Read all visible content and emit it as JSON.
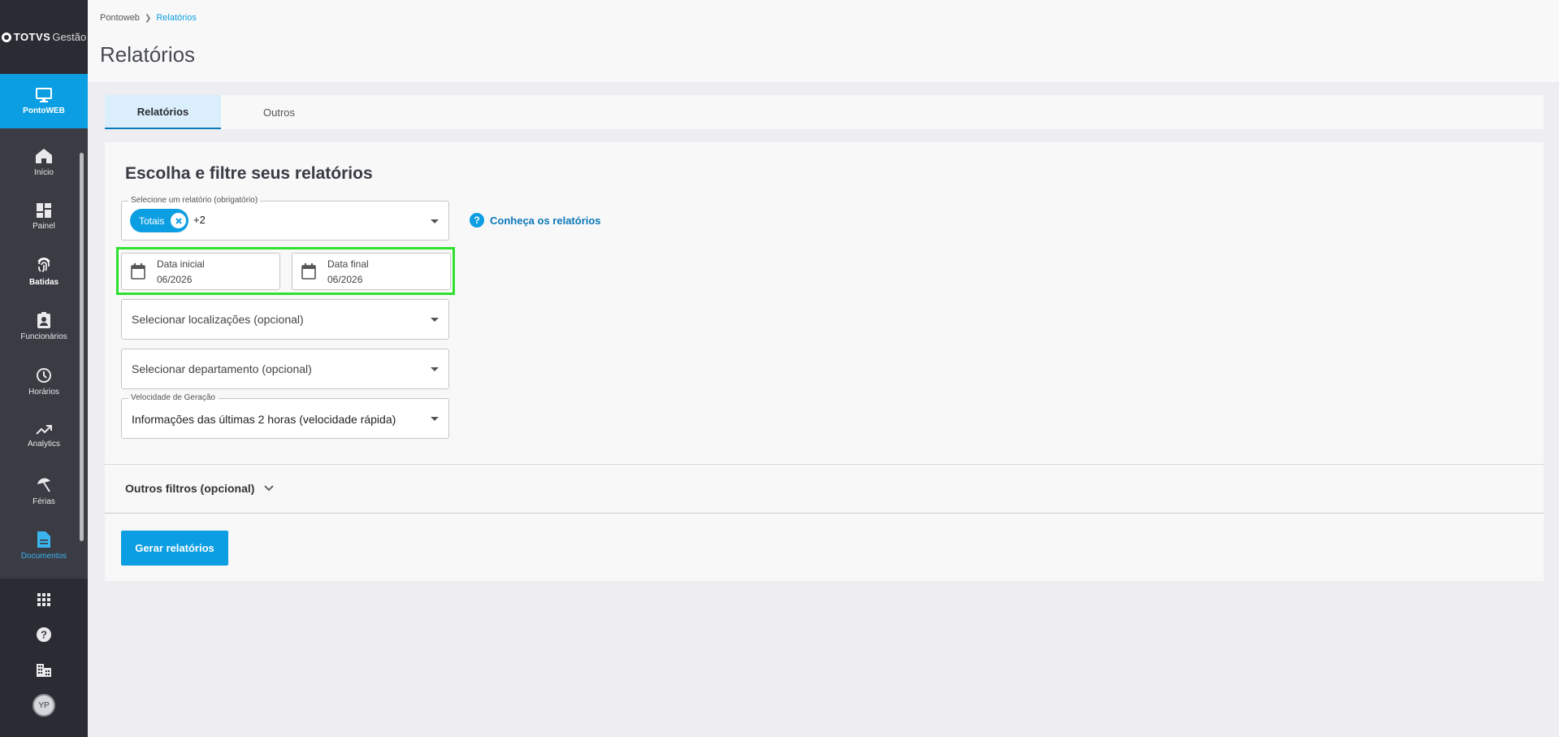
{
  "sidebar": {
    "logo": {
      "brand": "TOTVS",
      "suffix": "Gestão"
    },
    "module": {
      "label": "PontoWEB",
      "icon": "monitor-icon"
    },
    "items": [
      {
        "label": "Início",
        "icon": "home-icon"
      },
      {
        "label": "Painel",
        "icon": "dashboard-icon"
      },
      {
        "label": "Batidas",
        "icon": "fingerprint-icon"
      },
      {
        "label": "Funcionários",
        "icon": "id-badge-icon"
      },
      {
        "label": "Horários",
        "icon": "clock-icon"
      },
      {
        "label": "Analytics",
        "icon": "trending-up-icon"
      },
      {
        "label": "Férias",
        "icon": "beach-umbrella-icon"
      },
      {
        "label": "Documentos",
        "icon": "document-icon"
      }
    ],
    "active_item": "Documentos",
    "avatar_initials": "YP"
  },
  "header": {
    "breadcrumb": [
      "Pontoweb",
      "Relatórios"
    ],
    "title": "Relatórios"
  },
  "tabs": [
    {
      "label": "Relatórios",
      "active": true
    },
    {
      "label": "Outros",
      "active": false
    }
  ],
  "form": {
    "title": "Escolha e filtre seus relatórios",
    "report_select": {
      "legend": "Selecione um relatório (obrigatório)",
      "chip": "Totais",
      "more": "+2"
    },
    "help_link": "Conheça os relatórios",
    "start_date": {
      "label": "Data inicial",
      "value": "06/2026"
    },
    "end_date": {
      "label": "Data final",
      "value": "06/2026"
    },
    "locations_placeholder": "Selecionar localizações (opcional)",
    "department_placeholder": "Selecionar departamento (opcional)",
    "speed": {
      "legend": "Velocidade de Geração",
      "value": "Informações das últimas 2 horas (velocidade rápida)"
    },
    "other_filters": "Outros filtros (opcional)",
    "submit_label": "Gerar relatórios"
  },
  "colors": {
    "accent": "#0c9ee2",
    "sidebar": "#3a3b43",
    "highlight": "#2fe12f"
  }
}
